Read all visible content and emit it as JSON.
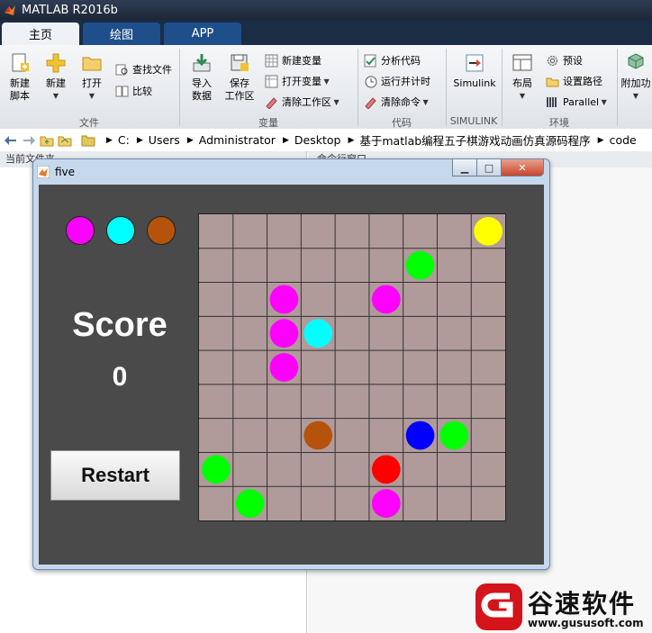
{
  "app": {
    "title": "MATLAB R2016b"
  },
  "tabs": [
    "主页",
    "绘图",
    "APP"
  ],
  "ribbon": {
    "new_script": "新建\n脚本",
    "new": "新建",
    "open": "打开",
    "find_files": "查找文件",
    "compare": "比较",
    "file_group": "文件",
    "import_data": "导入\n数据",
    "save_workspace": "保存\n工作区",
    "new_variable": "新建变量",
    "open_variable": "打开变量",
    "clear_workspace": "清除工作区",
    "variable_group": "变量",
    "analyze_code": "分析代码",
    "run_and_time": "运行并计时",
    "clear_commands": "清除命令",
    "code_group": "代码",
    "simulink": "Simulink",
    "simulink_group": "SIMULINK",
    "layout": "布局",
    "preferences": "预设",
    "set_path": "设置路径",
    "parallel": "Parallel",
    "environment_group": "环境",
    "add_ons": "附加功"
  },
  "address": {
    "path": [
      "C:",
      "Users",
      "Administrator",
      "Desktop",
      "基于matlab编程五子棋游戏动画仿真源码程序",
      "code"
    ]
  },
  "panes": {
    "left_header": "当前文件夹",
    "right_header": "命令行窗口"
  },
  "figure": {
    "title": "five",
    "score_label": "Score",
    "score_value": "0",
    "restart_label": "Restart",
    "legend_colors": [
      "#ff00ff",
      "#00ffff",
      "#b5530d"
    ],
    "board": {
      "rows": 9,
      "cols": 9,
      "pieces": [
        {
          "row": 0,
          "col": 8,
          "color": "#ffff00"
        },
        {
          "row": 1,
          "col": 6,
          "color": "#00ff00"
        },
        {
          "row": 2,
          "col": 2,
          "color": "#ff00ff"
        },
        {
          "row": 2,
          "col": 5,
          "color": "#ff00ff"
        },
        {
          "row": 3,
          "col": 2,
          "color": "#ff00ff"
        },
        {
          "row": 3,
          "col": 3,
          "color": "#00ffff"
        },
        {
          "row": 4,
          "col": 2,
          "color": "#ff00ff"
        },
        {
          "row": 6,
          "col": 3,
          "color": "#b5530d"
        },
        {
          "row": 6,
          "col": 6,
          "color": "#0000ff"
        },
        {
          "row": 6,
          "col": 7,
          "color": "#00ff00"
        },
        {
          "row": 7,
          "col": 0,
          "color": "#00ff00"
        },
        {
          "row": 7,
          "col": 5,
          "color": "#ff0000"
        },
        {
          "row": 8,
          "col": 1,
          "color": "#00ff00"
        },
        {
          "row": 8,
          "col": 5,
          "color": "#ff00ff"
        }
      ]
    }
  },
  "watermark": {
    "brand": "谷速软件",
    "url": "www.gususoft.com"
  }
}
